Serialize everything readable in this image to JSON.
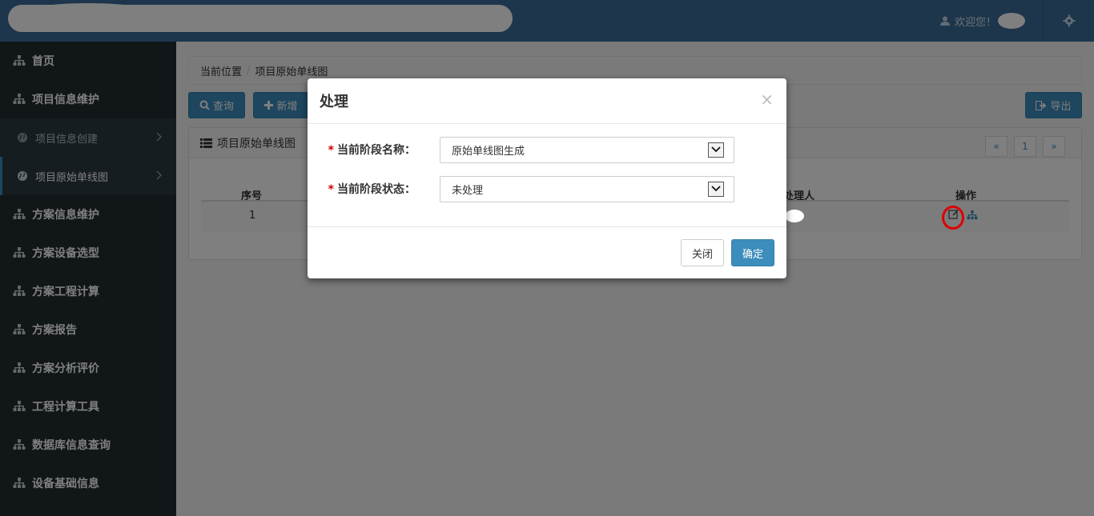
{
  "header": {
    "welcome_text": "欢迎您！",
    "user_icon": "user-icon",
    "settings_icon": "gear-icon"
  },
  "sidebar": {
    "items": [
      {
        "label": "首页",
        "icon": "sitemap-icon",
        "type": "top"
      },
      {
        "label": "项目信息维护",
        "icon": "sitemap-icon",
        "type": "top"
      },
      {
        "label": "项目信息创建",
        "icon": "globe-icon",
        "type": "sub"
      },
      {
        "label": "项目原始单线图",
        "icon": "globe-icon",
        "type": "sub-active"
      },
      {
        "label": "方案信息维护",
        "icon": "sitemap-icon",
        "type": "top"
      },
      {
        "label": "方案设备选型",
        "icon": "sitemap-icon",
        "type": "top"
      },
      {
        "label": "方案工程计算",
        "icon": "sitemap-icon",
        "type": "top"
      },
      {
        "label": "方案报告",
        "icon": "sitemap-icon",
        "type": "top"
      },
      {
        "label": "方案分析评价",
        "icon": "sitemap-icon",
        "type": "top"
      },
      {
        "label": "工程计算工具",
        "icon": "sitemap-icon",
        "type": "top"
      },
      {
        "label": "数据库信息查询",
        "icon": "sitemap-icon",
        "type": "top"
      },
      {
        "label": "设备基础信息",
        "icon": "sitemap-icon",
        "type": "top"
      }
    ]
  },
  "breadcrumb": {
    "root": "当前位置",
    "separator": "/",
    "current": "项目原始单线图"
  },
  "toolbar": {
    "query_label": "查询",
    "add_label": "新增",
    "export_label": "导出"
  },
  "panel": {
    "title": "项目原始单线图",
    "pager": {
      "prev": "«",
      "page": "1",
      "next": "»"
    },
    "columns": {
      "index": "序号",
      "handler": "处理人",
      "actions": "操作"
    },
    "rows": [
      {
        "index": "1"
      }
    ]
  },
  "modal": {
    "title": "处理",
    "close_symbol": "×",
    "fields": [
      {
        "label": "当前阶段名称：",
        "value": "原始单线图生成",
        "required": "*"
      },
      {
        "label": "当前阶段状态：",
        "value": "未处理",
        "required": "*"
      }
    ],
    "close_button": "关闭",
    "confirm_button": "确定"
  },
  "colors": {
    "topbar": "#3a6d98",
    "sidebar": "#222d32",
    "primary": "#3c8dbc",
    "required": "#cc0000"
  }
}
